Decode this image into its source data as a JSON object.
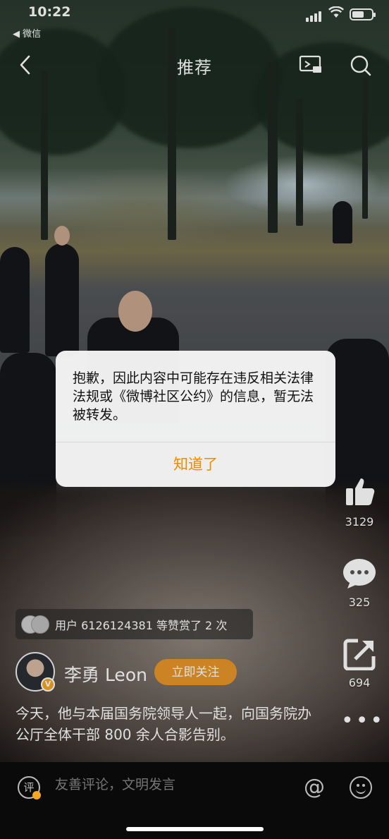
{
  "status_bar": {
    "time": "10:22",
    "back_app": "◀ 微信"
  },
  "nav": {
    "title": "推荐"
  },
  "actions": {
    "like_count": "3129",
    "comment_count": "325",
    "share_count": "694"
  },
  "reward": {
    "text": "用户 6126124381 等赞赏了 2 次"
  },
  "author": {
    "name": "李勇 Leon",
    "follow_label": "立即关注",
    "badge": "V"
  },
  "post": {
    "text": "今天，他与本届国务院领导人一起，向国务院办公厅全体干部 800 余人合影告别。"
  },
  "comment_bar": {
    "icon_label": "评",
    "placeholder": "友善评论，文明发言"
  },
  "dialog": {
    "message": "抱歉，因此内容中可能存在违反相关法律法规或《微博社区公约》的信息，暂无法被转发。",
    "ok_label": "知道了"
  },
  "colors": {
    "accent": "#f08a00",
    "follow_button": "#e8962a",
    "badge": "#f5a623"
  }
}
